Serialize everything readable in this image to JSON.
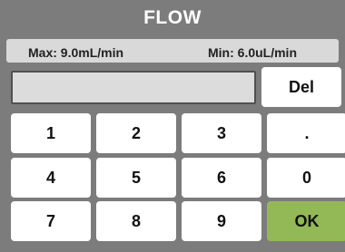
{
  "title": "FLOW",
  "range": {
    "max_label": "Max: 9.0mL/min",
    "min_label": "Min: 6.0uL/min"
  },
  "entry": {
    "value": ""
  },
  "keys": {
    "del": "Del",
    "one": "1",
    "two": "2",
    "three": "3",
    "dot": ".",
    "four": "4",
    "five": "5",
    "six": "6",
    "zero": "0",
    "seven": "7",
    "eight": "8",
    "nine": "9",
    "ok": "OK"
  },
  "colors": {
    "panel": "#7c7c7c",
    "key": "#ffffff",
    "ok": "#93b956"
  }
}
